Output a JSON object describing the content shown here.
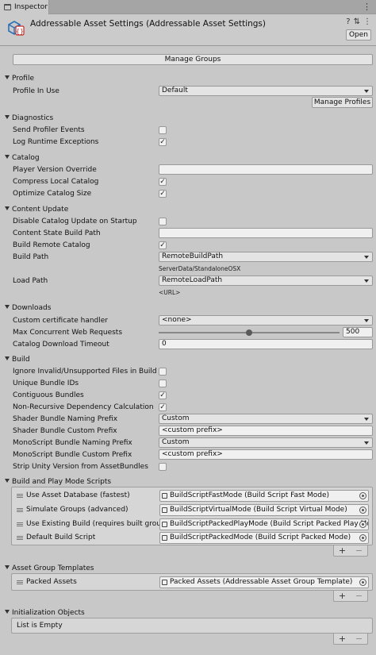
{
  "window": {
    "tab_title": "Inspector",
    "header_title": "Addressable Asset Settings (Addressable Asset Settings)",
    "open_label": "Open",
    "tool_icons": [
      "help-icon",
      "preset-icon",
      "more-icon"
    ]
  },
  "manage_groups_label": "Manage Groups",
  "profile": {
    "section": "Profile",
    "in_use_label": "Profile In Use",
    "in_use_value": "Default",
    "manage_profiles_label": "Manage Profiles"
  },
  "diagnostics": {
    "section": "Diagnostics",
    "send_profiler_events": "Send Profiler Events",
    "send_profiler_events_checked": false,
    "log_runtime_exceptions": "Log Runtime Exceptions",
    "log_runtime_exceptions_checked": true
  },
  "catalog": {
    "section": "Catalog",
    "player_version_override": "Player Version Override",
    "player_version_override_value": "",
    "compress_local_catalog": "Compress Local Catalog",
    "compress_local_catalog_checked": true,
    "optimize_catalog_size": "Optimize Catalog Size",
    "optimize_catalog_size_checked": true
  },
  "content_update": {
    "section": "Content Update",
    "disable_catalog_update": "Disable Catalog Update on Startup",
    "disable_catalog_update_checked": false,
    "content_state_build_path": "Content State Build Path",
    "content_state_build_path_value": "",
    "build_remote_catalog": "Build Remote Catalog",
    "build_remote_catalog_checked": true,
    "build_path": "Build Path",
    "build_path_value": "RemoteBuildPath",
    "build_path_resolved": "ServerData/StandaloneOSX",
    "load_path": "Load Path",
    "load_path_value": "RemoteLoadPath",
    "load_path_resolved": "<URL>"
  },
  "downloads": {
    "section": "Downloads",
    "custom_certificate_handler": "Custom certificate handler",
    "custom_certificate_handler_value": "<none>",
    "max_concurrent_web_requests": "Max Concurrent Web Requests",
    "max_concurrent_web_requests_value": "500",
    "max_concurrent_fraction": 0.5,
    "catalog_download_timeout": "Catalog Download Timeout",
    "catalog_download_timeout_value": "0"
  },
  "build": {
    "section": "Build",
    "ignore_invalid_files": "Ignore Invalid/Unsupported Files in Build",
    "ignore_invalid_files_checked": false,
    "unique_bundle_ids": "Unique Bundle IDs",
    "unique_bundle_ids_checked": false,
    "contiguous_bundles": "Contiguous Bundles",
    "contiguous_bundles_checked": true,
    "non_recursive_dependency": "Non-Recursive Dependency Calculation",
    "non_recursive_dependency_checked": true,
    "shader_bundle_naming_prefix": "Shader Bundle Naming Prefix",
    "shader_bundle_naming_prefix_value": "Custom",
    "shader_bundle_custom_prefix": "Shader Bundle Custom Prefix",
    "shader_bundle_custom_prefix_value": "<custom prefix>",
    "monoscript_bundle_naming_prefix": "MonoScript Bundle Naming Prefix",
    "monoscript_bundle_naming_prefix_value": "Custom",
    "monoscript_bundle_custom_prefix": "MonoScript Bundle Custom Prefix",
    "monoscript_bundle_custom_prefix_value": "<custom prefix>",
    "strip_unity_version": "Strip Unity Version from AssetBundles",
    "strip_unity_version_checked": false
  },
  "build_play_mode": {
    "section": "Build and Play Mode Scripts",
    "items": [
      {
        "label": "Use Asset Database (fastest)",
        "value": "BuildScriptFastMode (Build Script Fast Mode)"
      },
      {
        "label": "Simulate Groups (advanced)",
        "value": "BuildScriptVirtualMode (Build Script Virtual Mode)"
      },
      {
        "label": "Use Existing Build (requires built groups)",
        "value": "BuildScriptPackedPlayMode (Build Script Packed Play Mode)"
      },
      {
        "label": "Default Build Script",
        "value": "BuildScriptPackedMode (Build Script Packed Mode)"
      }
    ]
  },
  "asset_group_templates": {
    "section": "Asset Group Templates",
    "items": [
      {
        "label": "Packed Assets",
        "value": "Packed Assets (Addressable Asset Group Template)"
      }
    ]
  },
  "initialization_objects": {
    "section": "Initialization Objects",
    "empty_text": "List is Empty"
  },
  "list_controls": {
    "add": "+",
    "remove": "−"
  },
  "check_mark": "✓"
}
